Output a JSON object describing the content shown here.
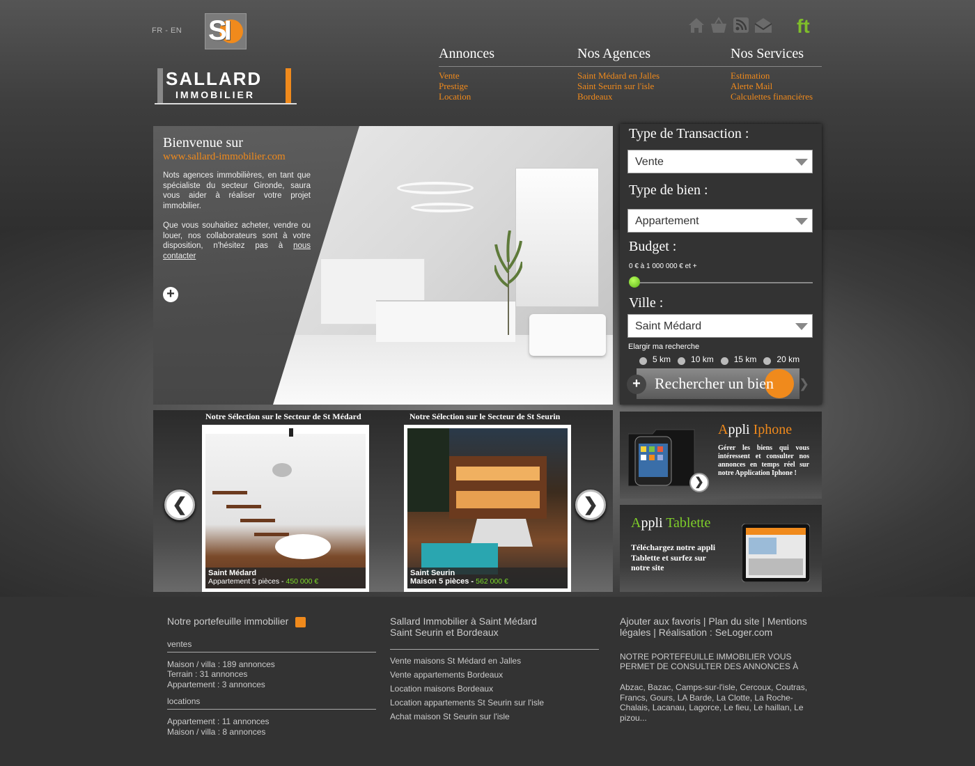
{
  "header": {
    "lang": "FR - EN",
    "logo_mark": "SI",
    "brand_name": "SALLARD",
    "brand_sub": "IMMOBILIER",
    "icons": [
      "home-icon",
      "basket-icon",
      "rss-icon",
      "mail-icon"
    ],
    "social": "ft"
  },
  "nav": [
    {
      "title": "Annonces",
      "links": [
        "Vente",
        "Prestige",
        "Location"
      ]
    },
    {
      "title": "Nos Agences",
      "links": [
        "Saint Médard en Jalles",
        "Saint Seurin sur l'isle",
        "Bordeaux"
      ]
    },
    {
      "title": "Nos Services",
      "links": [
        "Estimation",
        "Alerte Mail",
        "Calculettes financières"
      ]
    }
  ],
  "hero": {
    "title": "Bienvenue sur",
    "url": "www.sallard-immobilier.com",
    "p1": "Nots agences immobilières, en tant que spécialiste du secteur Gironde, saura vous aider à réaliser votre projet immobilier.",
    "p2": "Que vous souhaitiez acheter, vendre ou louer, nos collaborateurs sont à votre disposition, n'hésitez  pas à",
    "p2_link": "nous contacter"
  },
  "search": {
    "transaction_label": "Type de Transaction :",
    "transaction_value": "Vente",
    "bien_label": "Type de bien :",
    "bien_value": "Appartement",
    "budget_label": "Budget :",
    "budget_range": "0 € à 1 000 000 € et +",
    "budget_slider_fraction": 0,
    "ville_label": "Ville :",
    "ville_value": "Saint Médard",
    "elargir": "Elargir ma recherche",
    "radius_options": [
      "5 km",
      "10 km",
      "15 km",
      "20 km"
    ],
    "button": "Rechercher un bien"
  },
  "selection": [
    {
      "title": "Notre Sélection sur le Secteur de St Médard",
      "place": "Saint Médard",
      "desc": "Appartement 5 pièces - ",
      "price": "450 000 €"
    },
    {
      "title": "Notre Sélection sur le Secteur de St Seurin",
      "place": "Saint Seurin",
      "desc": "Maison 5 pièces - ",
      "price": "562 000 €"
    }
  ],
  "apps": {
    "iphone": {
      "a": "A",
      "ppli": "ppli",
      "name": "Iphone",
      "text": "Gérer les biens qui vous intéressent et consulter nos annonces en temps réel sur notre Application Iphone !"
    },
    "tablette": {
      "a": "A",
      "ppli": "ppli",
      "name": "Tablette",
      "text": "Téléchargez notre appli  Tablette et surfez sur notre site"
    }
  },
  "footer": {
    "col1": {
      "title": "Notre portefeuille immobilier",
      "ventes": "ventes",
      "ventes_items": [
        "Maison / villa : 189 annonces",
        "Terrain : 31 annonces",
        "Appartement : 3 annonces"
      ],
      "locations": "locations",
      "locations_items": [
        " Appartement : 11 annonces",
        "Maison / villa : 8 annonces"
      ]
    },
    "col2": {
      "title": "Sallard Immobilier à Saint Médard Saint Seurin et Bordeaux",
      "links": [
        "Vente maisons St Médard en Jalles",
        "Vente appartements Bordeaux",
        "Location maisons Bordeaux",
        "Location appartements St Seurin sur l'isle",
        "Achat maison St Seurin sur l'isle"
      ]
    },
    "col3": {
      "top": "Ajouter aux favoris | Plan du site | Mentions légales | Réalisation : SeLoger.com",
      "heading": "NOTRE PORTEFEUILLE IMMOBILIER VOUS PERMET DE CONSULTER DES ANNONCES À",
      "cities": "Abzac, Bazac, Camps-sur-l'isle, Cercoux, Coutras, Francs, Gours, LA Barde, La Clotte, La Roche-Chalais, Lacanau, Lagorce, Le fieu, Le haillan, Le pizou..."
    }
  }
}
